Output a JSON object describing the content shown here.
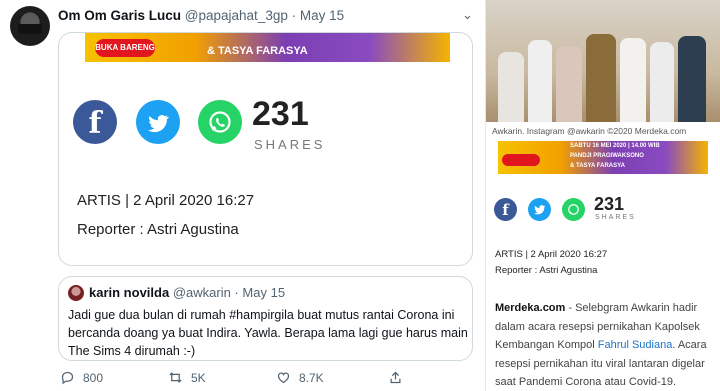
{
  "tweet": {
    "name": "Om Om Garis Lucu",
    "handle": "@papajahat_3gp",
    "dot": "·",
    "date": "May 15",
    "caret": "⌄",
    "card": {
      "banner_pill": "BUKA BARENG",
      "banner_text": "& TASYA FARASYA",
      "share_count": "231",
      "shares_label": "SHARES",
      "artis_line": "ARTIS | 2 April 2020 16:27",
      "reporter_line": "Reporter : Astri Agustina"
    },
    "quote": {
      "name": "karin novilda",
      "handle": "@awkarin",
      "dot": "·",
      "date": "May 15",
      "text": "Jadi gue dua bulan di rumah #hampirgila buat mutus rantai Corona ini bercanda doang ya buat Indira. Yawla. Berapa lama lagi gue harus main The Sims 4 dirumah :-)"
    },
    "actions": {
      "replies": "800",
      "retweets": "5K",
      "likes": "8.7K"
    }
  },
  "article": {
    "caption": "Awkarin. Instagram @awkarin ©2020 Merdeka.com",
    "banner_line1": "SABTU 16 MEI 2020 | 14.00 WIB",
    "banner_line2": "PANDJI PRAGIWAKSONO",
    "banner_line3": "& TASYA FARASYA",
    "share_count": "231",
    "shares_label": "SHARES",
    "artis_line": "ARTIS | 2 April 2020 16:27",
    "reporter_line": "Reporter : Astri Agustina",
    "body_source": "Merdeka.com",
    "body_text1": " - Selebgram Awkarin hadir dalam acara resepsi pernikahan Kapolsek Kembangan Kompol ",
    "body_link": "Fahrul Sudiana",
    "body_text2": ". Acara resepsi pernikahan itu viral lantaran digelar saat Pandemi Corona atau Covid-19."
  },
  "colors": {
    "facebook": "#3b5998",
    "twitter": "#1da1f2",
    "whatsapp": "#25d366"
  },
  "icons": [
    "facebook-icon",
    "twitter-icon",
    "whatsapp-icon",
    "reply-icon",
    "retweet-icon",
    "like-icon",
    "share-icon",
    "chevron-down-icon"
  ]
}
